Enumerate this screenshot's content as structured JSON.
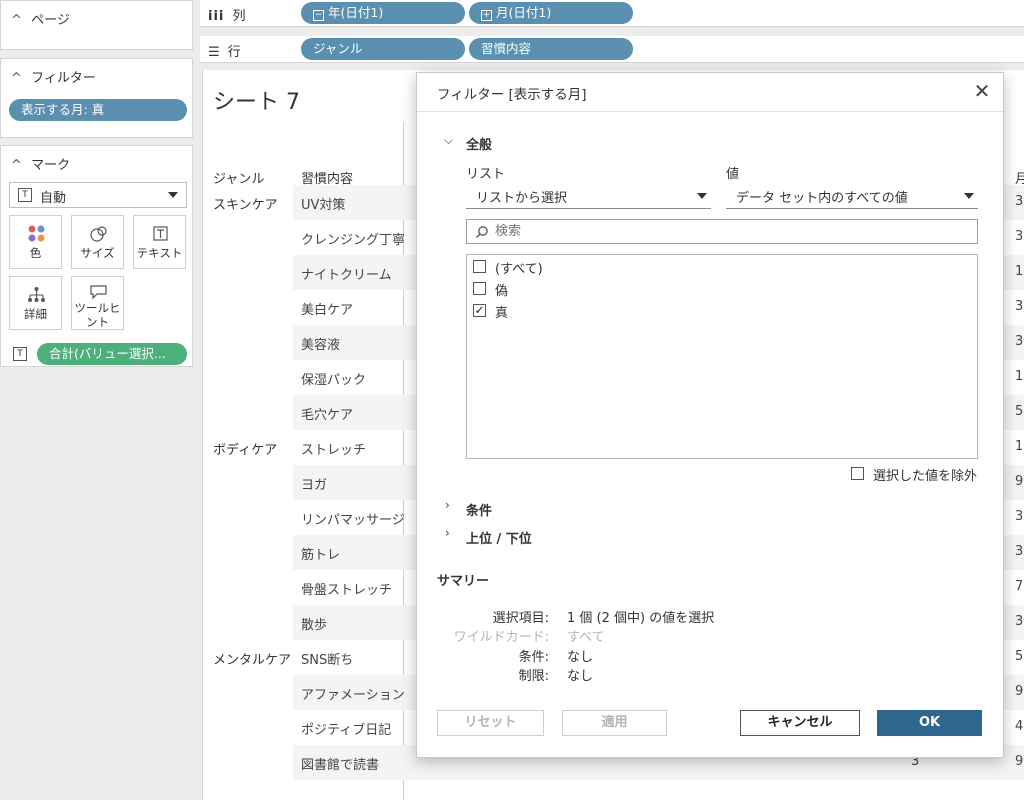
{
  "panels": {
    "pages": {
      "title": "ページ"
    },
    "filters": {
      "title": "フィルター",
      "pill": "表示する月: 真"
    },
    "marks": {
      "title": "マーク",
      "mark_type": "自動",
      "buttons": {
        "color": "色",
        "size": "サイズ",
        "text": "テキスト",
        "detail": "詳細",
        "tooltip_line1": "ツールヒ",
        "tooltip_line2": "ント"
      },
      "pill": "合計(バリュー選択..."
    }
  },
  "shelves": {
    "columns": {
      "label": "列",
      "pills": [
        "年(日付1)",
        "月(日付1)"
      ]
    },
    "rows": {
      "label": "行",
      "pills": [
        "ジャンル",
        "習慣内容"
      ]
    }
  },
  "view": {
    "sheet_title": "シート 7",
    "col_genre": "ジャンル",
    "col_item": "習慣内容",
    "right_header": "月",
    "rows": [
      {
        "genre": "スキンケア",
        "item": "UV対策",
        "right": "3"
      },
      {
        "genre": "",
        "item": "クレンジング丁寧",
        "right": "3"
      },
      {
        "genre": "",
        "item": "ナイトクリーム",
        "right": "1"
      },
      {
        "genre": "",
        "item": "美白ケア",
        "right": "3"
      },
      {
        "genre": "",
        "item": "美容液",
        "right": "3"
      },
      {
        "genre": "",
        "item": "保湿パック",
        "right": "1"
      },
      {
        "genre": "",
        "item": "毛穴ケア",
        "right": "5"
      },
      {
        "genre": "ボディケア",
        "item": "ストレッチ",
        "right": "1"
      },
      {
        "genre": "",
        "item": "ヨガ",
        "right": "9"
      },
      {
        "genre": "",
        "item": "リンパマッサージ",
        "right": "3"
      },
      {
        "genre": "",
        "item": "筋トレ",
        "right": "3"
      },
      {
        "genre": "",
        "item": "骨盤ストレッチ",
        "right": "7"
      },
      {
        "genre": "",
        "item": "散歩",
        "right": "3"
      },
      {
        "genre": "メンタルケア",
        "item": "SNS断ち",
        "right": "5"
      },
      {
        "genre": "",
        "item": "アファメーション",
        "right": "9"
      },
      {
        "genre": "",
        "item": "ポジティブ日記",
        "right": "4"
      },
      {
        "genre": "",
        "item": "図書館で読書",
        "mid": "3",
        "right": "9"
      }
    ]
  },
  "dialog": {
    "title": "フィルター [表示する月]",
    "general": "全般",
    "list_label": "リスト",
    "list_value": "リストから選択",
    "value_label": "値",
    "value_value": "データ セット内のすべての値",
    "search_placeholder": "検索",
    "options": [
      {
        "label": "(すべて)",
        "checked": false
      },
      {
        "label": "偽",
        "checked": false
      },
      {
        "label": "真",
        "checked": true
      }
    ],
    "exclude_label": "選択した値を除外",
    "condition": "条件",
    "topbottom": "上位 / 下位",
    "summary_title": "サマリー",
    "summary": [
      {
        "key": "選択項目:",
        "value": "1 個 (2 個中) の値を選択",
        "dim": false
      },
      {
        "key": "ワイルドカード:",
        "value": "すべて",
        "dim": true
      },
      {
        "key": "条件:",
        "value": "なし",
        "dim": false
      },
      {
        "key": "制限:",
        "value": "なし",
        "dim": false
      }
    ],
    "buttons": {
      "reset": "リセット",
      "apply": "適用",
      "cancel": "キャンセル",
      "ok": "OK"
    }
  },
  "colors": {
    "pill_blue": "#5b8fb0",
    "pill_green": "#4daf7c",
    "ok_button": "#2e6690"
  }
}
